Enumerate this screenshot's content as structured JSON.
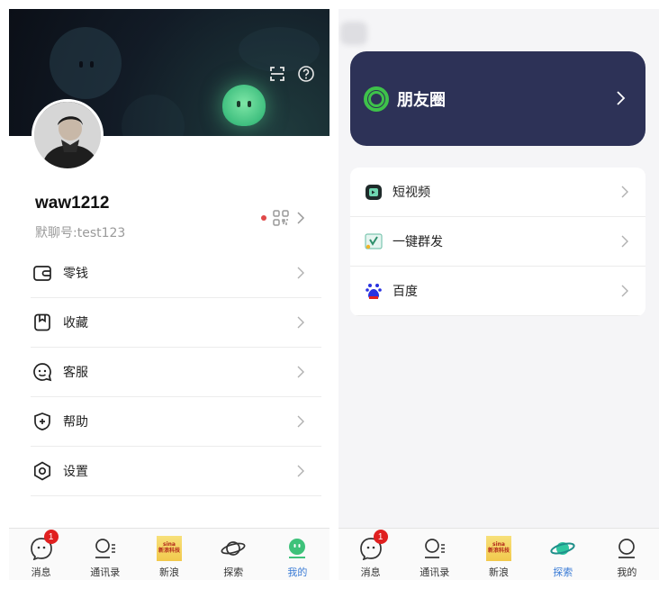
{
  "profile": {
    "username": "waw1212",
    "wechat_id": "默聊号:test123"
  },
  "profile_menu": [
    {
      "label": "零钱",
      "icon": "wallet-icon"
    },
    {
      "label": "收藏",
      "icon": "bookmark-icon"
    },
    {
      "label": "客服",
      "icon": "customer-service-icon"
    },
    {
      "label": "帮助",
      "icon": "help-shield-icon"
    },
    {
      "label": "设置",
      "icon": "settings-icon"
    }
  ],
  "explore": {
    "moments_label": "朋友圈",
    "items": [
      {
        "label": "短视频",
        "icon": "short-video-icon"
      },
      {
        "label": "一键群发",
        "icon": "broadcast-icon"
      },
      {
        "label": "百度",
        "icon": "baidu-icon"
      }
    ]
  },
  "tabs": [
    {
      "label": "消息",
      "icon": "message-icon",
      "badge": "1"
    },
    {
      "label": "通讯录",
      "icon": "contacts-icon"
    },
    {
      "label": "新浪",
      "icon": "sina-icon",
      "logo_text_top": "sina",
      "logo_text_bottom": "新浪科技"
    },
    {
      "label": "探索",
      "icon": "planet-icon"
    },
    {
      "label": "我的",
      "icon": "me-icon"
    }
  ],
  "colors": {
    "accent": "#3a7bd5",
    "moments_card": "#2d3257",
    "moments_ring": "#3ec24a",
    "badge": "#e02020",
    "brand_green": "#3fbf7f"
  }
}
